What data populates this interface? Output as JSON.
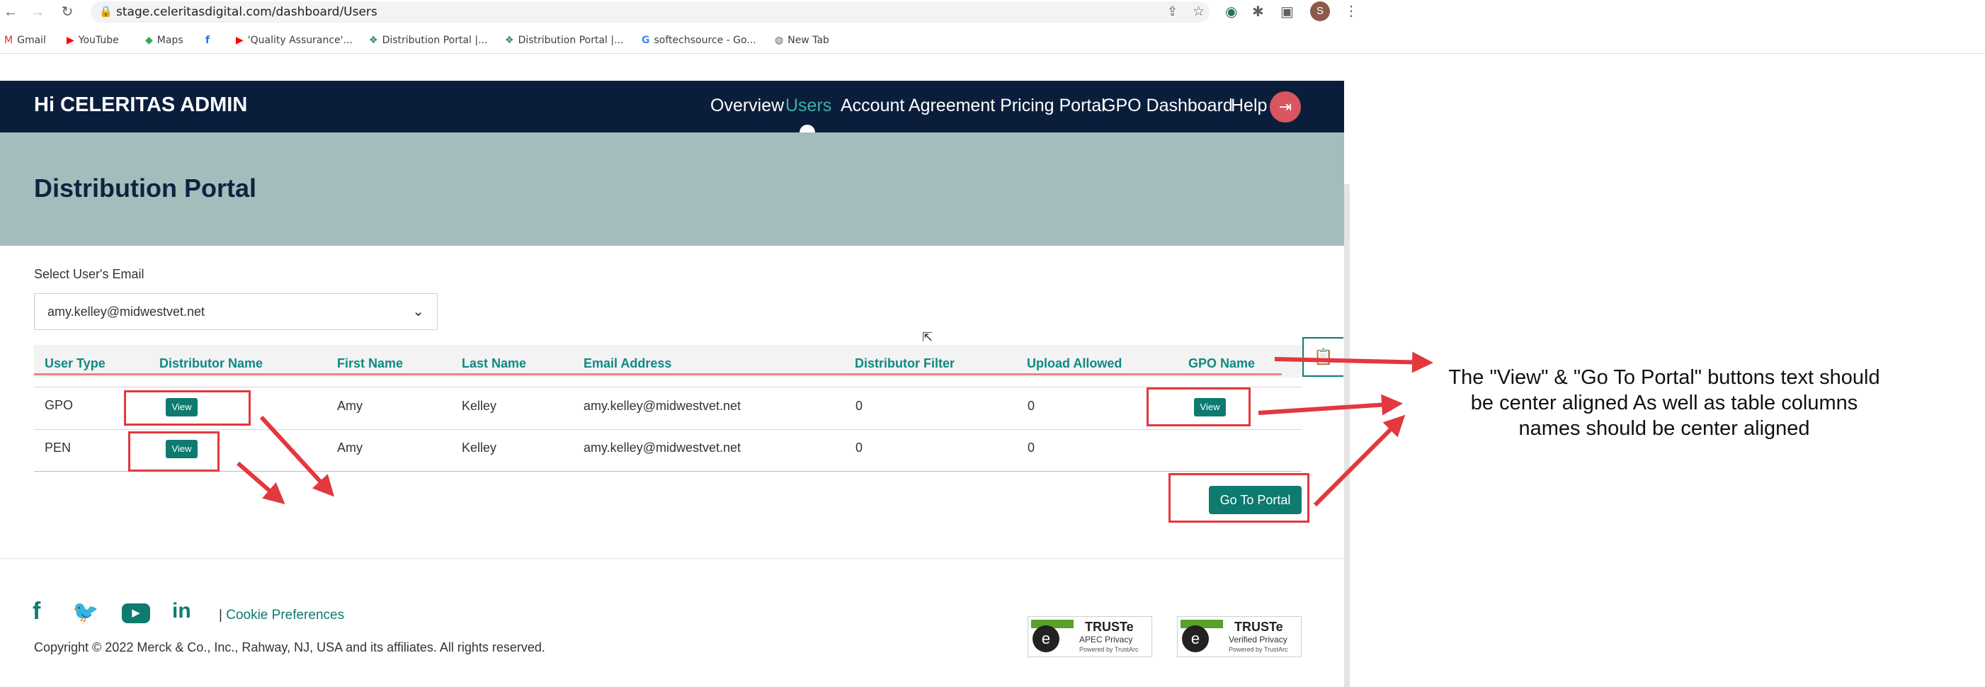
{
  "browser": {
    "url": "stage.celeritasdigital.com/dashboard/Users",
    "profile_initial": "S",
    "bookmarks": [
      {
        "label": "Gmail",
        "icon": "gmail-icon"
      },
      {
        "label": "YouTube",
        "icon": "youtube-icon"
      },
      {
        "label": "Maps",
        "icon": "maps-icon"
      },
      {
        "label": "",
        "icon": "facebook-icon"
      },
      {
        "label": "'Quality Assurance'...",
        "icon": "youtube-icon"
      },
      {
        "label": "Distribution Portal |...",
        "icon": "portal-icon"
      },
      {
        "label": "Distribution Portal |...",
        "icon": "portal-icon"
      },
      {
        "label": "softechsource - Go...",
        "icon": "google-icon"
      },
      {
        "label": "New Tab",
        "icon": "globe-icon"
      }
    ]
  },
  "header": {
    "greeting": "Hi CELERITAS ADMIN",
    "nav": [
      {
        "label": "Overview",
        "active": false
      },
      {
        "label": "Users",
        "active": true
      },
      {
        "label": "Account Agreement Pricing Portal",
        "active": false
      },
      {
        "label": "GPO Dashboard",
        "active": false
      },
      {
        "label": "Help",
        "active": false
      }
    ],
    "active_color": "#3fb0a8"
  },
  "banner": {
    "title": "Distribution Portal"
  },
  "select": {
    "label": "Select User's Email",
    "value": "amy.kelley@midwestvet.net"
  },
  "table": {
    "headers": [
      "User Type",
      "Distributor Name",
      "First Name",
      "Last Name",
      "Email Address",
      "Distributor Filter",
      "Upload Allowed",
      "GPO Name"
    ],
    "rows": [
      {
        "user_type": "GPO",
        "distributor_name": "View",
        "first_name": "Amy",
        "last_name": "Kelley",
        "email": "amy.kelley@midwestvet.net",
        "distributor_filter": "0",
        "upload_allowed": "0",
        "gpo_name": "View"
      },
      {
        "user_type": "PEN",
        "distributor_name": "View",
        "first_name": "Amy",
        "last_name": "Kelley",
        "email": "amy.kelley@midwestvet.net",
        "distributor_filter": "0",
        "upload_allowed": "0",
        "gpo_name": ""
      }
    ]
  },
  "actions": {
    "go_to_portal": "Go To Portal"
  },
  "footer": {
    "cookie_separator": "|",
    "cookie": "Cookie Preferences",
    "copyright": "Copyright © 2022 Merck & Co., Inc., Rahway, NJ, USA and its affiliates. All rights reserved.",
    "badges": [
      {
        "title": "TRUSTe",
        "line1": "APEC Privacy",
        "line2": "Powered by TrustArc"
      },
      {
        "title": "TRUSTe",
        "line1": "Verified Privacy",
        "line2": "Powered by TrustArc"
      }
    ]
  },
  "annotation": {
    "line1": "The \"View\" & \"Go To Portal\" buttons text should",
    "line2": "be center aligned  As well as table columns",
    "line3": "names should be center aligned",
    "color": "#e2383e"
  }
}
